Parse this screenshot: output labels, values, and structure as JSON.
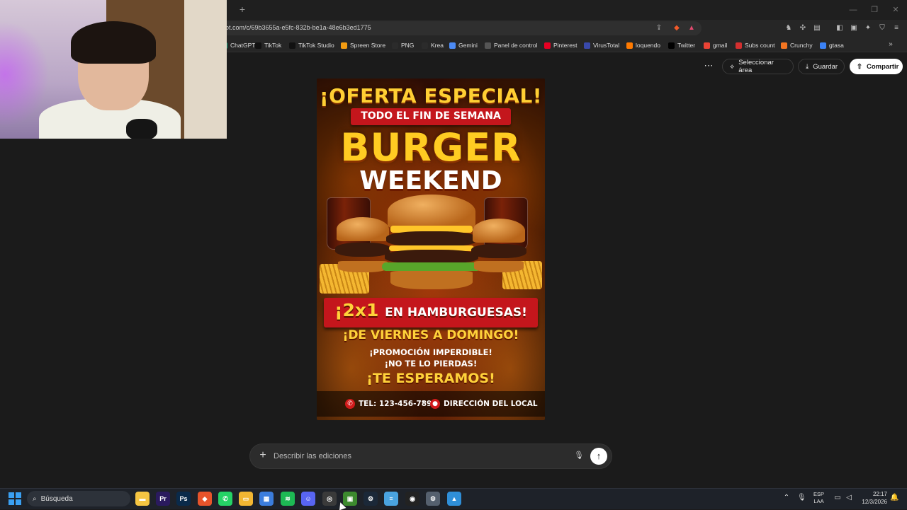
{
  "browser": {
    "url": "ot.com/c/69b3655a-e5fc-832b-be1a-48e6b3ed1775",
    "newtab_label": "+",
    "bookmarks": [
      {
        "label": "ChatGPT",
        "color": "#10a37f"
      },
      {
        "label": "TikTok",
        "color": "#111111"
      },
      {
        "label": "TikTok Studio",
        "color": "#111111"
      },
      {
        "label": "Spreen Store",
        "color": "#f39c12"
      },
      {
        "label": "PNG",
        "color": "#2b2b2b"
      },
      {
        "label": "Krea",
        "color": "#2b2b2b"
      },
      {
        "label": "Gemini",
        "color": "#4c8bf5"
      },
      {
        "label": "Panel de control",
        "color": "#555555"
      },
      {
        "label": "Pinterest",
        "color": "#e60023"
      },
      {
        "label": "VirusTotal",
        "color": "#3949ab"
      },
      {
        "label": "loquendo",
        "color": "#ff7a00"
      },
      {
        "label": "Twitter",
        "color": "#000000"
      },
      {
        "label": "gmail",
        "color": "#ea4335"
      },
      {
        "label": "Subs count",
        "color": "#d32f2f"
      },
      {
        "label": "Crunchy",
        "color": "#f47521"
      },
      {
        "label": "gtasa",
        "color": "#3b82f6"
      }
    ]
  },
  "toolbar": {
    "more_label": "⋯",
    "select_area_label": "Seleccionar área",
    "save_label": "Guardar",
    "share_label": "Compartir"
  },
  "poster": {
    "headline": "¡OFERTA ESPECIAL!",
    "subhead": "TODO EL FIN DE SEMANA",
    "title_line1": "BURGER",
    "title_line2": "WEEKEND",
    "offer_big": "¡2x1",
    "offer_rest": "EN HAMBURGUESAS!",
    "days": "¡DE VIERNES A DOMINGO!",
    "promo_line1": "¡PROMOCIÓN IMPERDIBLE!",
    "promo_line2": "¡NO TE LO PIERDAS!",
    "closing": "¡TE ESPERAMOS!",
    "phone": "TEL: 123-456-7890",
    "separator": "•",
    "address": "DIRECCIÓN DEL LOCAL"
  },
  "prompt": {
    "placeholder": "Describir las ediciones"
  },
  "taskbar": {
    "search_label": "Búsqueda",
    "lang_line1": "ESP",
    "lang_line2": "LAA",
    "time": "22:17",
    "date": "12/3/2026",
    "apps": [
      {
        "name": "file-explorer",
        "color": "#f5c542",
        "glyph": "▬"
      },
      {
        "name": "premiere",
        "color": "#2a1a5e",
        "glyph": "Pr"
      },
      {
        "name": "photoshop",
        "color": "#0a2a4a",
        "glyph": "Ps"
      },
      {
        "name": "brave",
        "color": "#e8542b",
        "glyph": "◆"
      },
      {
        "name": "whatsapp",
        "color": "#25d366",
        "glyph": "✆"
      },
      {
        "name": "folder",
        "color": "#f2b632",
        "glyph": "▭"
      },
      {
        "name": "store",
        "color": "#3b7ddd",
        "glyph": "▦"
      },
      {
        "name": "spotify",
        "color": "#1db954",
        "glyph": "≋"
      },
      {
        "name": "discord",
        "color": "#5865f2",
        "glyph": "☺"
      },
      {
        "name": "chrome",
        "color": "#3a3a3a",
        "glyph": "◎"
      },
      {
        "name": "minecraft",
        "color": "#3c8a2e",
        "glyph": "▣"
      },
      {
        "name": "steam",
        "color": "#1b2838",
        "glyph": "⚙"
      },
      {
        "name": "notepad",
        "color": "#4aa3df",
        "glyph": "≡"
      },
      {
        "name": "obs",
        "color": "#222222",
        "glyph": "◉"
      },
      {
        "name": "settings",
        "color": "#55606e",
        "glyph": "⚙"
      },
      {
        "name": "photos",
        "color": "#2f8fd8",
        "glyph": "▲"
      }
    ]
  }
}
